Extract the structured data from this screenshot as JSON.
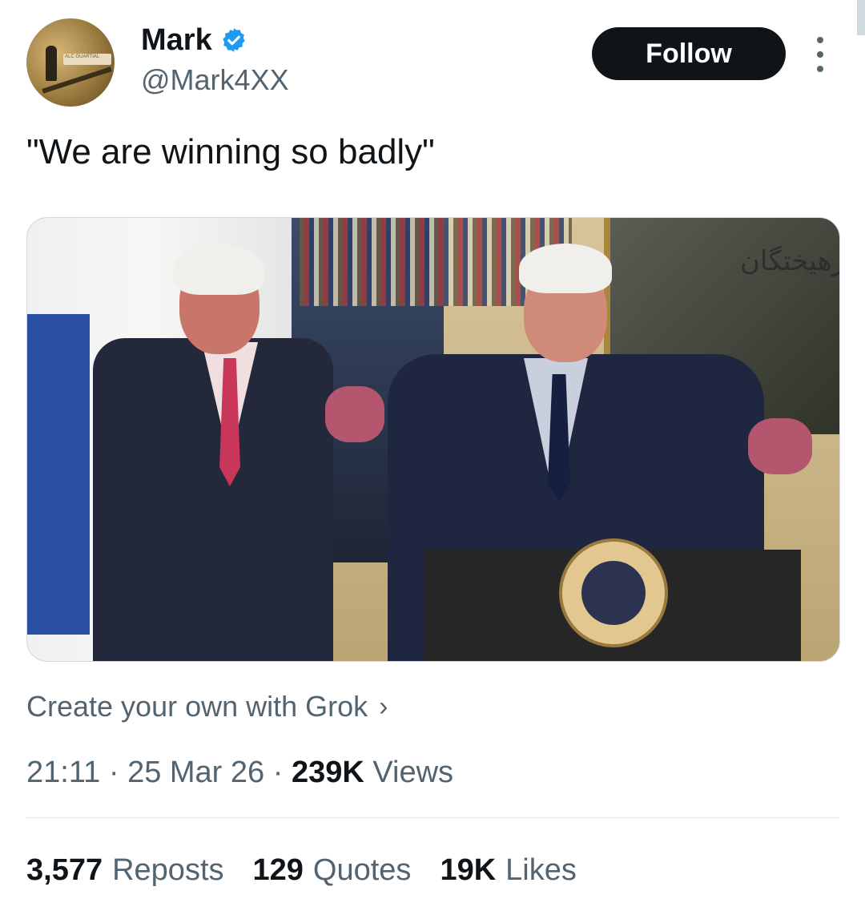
{
  "author": {
    "name": "Mark",
    "handle": "@Mark4XX",
    "verified": true,
    "avatar_caption": "ALC GUARTIAL"
  },
  "follow_button": {
    "label": "Follow"
  },
  "more_menu": {
    "icon": "more-vertical-icon"
  },
  "tweet": {
    "text": "\"We are winning so badly\"",
    "media": {
      "watermark": "فرهیختگان"
    },
    "grok_link": {
      "label": "Create your own with Grok",
      "chevron": "›"
    }
  },
  "meta": {
    "time": "21:11",
    "separator1": " · ",
    "date": "25 Mar 26",
    "separator2": " · ",
    "views_count": "239K",
    "views_label": "Views"
  },
  "stats": {
    "reposts": {
      "count": "3,577",
      "label": "Reposts"
    },
    "quotes": {
      "count": "129",
      "label": "Quotes"
    },
    "likes": {
      "count": "19K",
      "label": "Likes"
    }
  },
  "colors": {
    "text_primary": "#0f1419",
    "text_secondary": "#536471",
    "verified_blue": "#1d9bf0",
    "button_bg": "#0f1419"
  }
}
